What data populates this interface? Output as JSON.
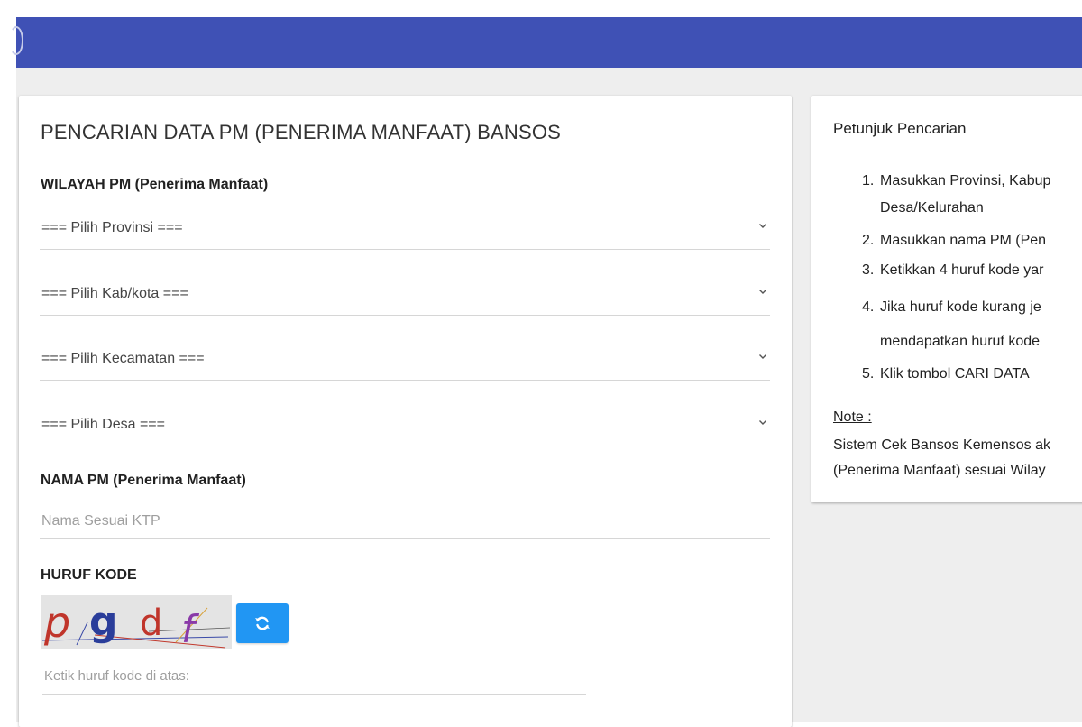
{
  "header": {
    "bar_color": "#3f51b5"
  },
  "search_form": {
    "title": "PENCARIAN DATA PM (PENERIMA MANFAAT) BANSOS",
    "wilayah_label": "WILAYAH PM (Penerima Manfaat)",
    "provinsi": {
      "selected": "=== Pilih Provinsi ==="
    },
    "kabkota": {
      "selected": "=== Pilih Kab/kota ==="
    },
    "kecamatan": {
      "selected": "=== Pilih Kecamatan ==="
    },
    "desa": {
      "selected": "=== Pilih Desa ==="
    },
    "nama_label": "NAMA PM (Penerima Manfaat)",
    "nama_input": {
      "placeholder": "Nama Sesuai KTP",
      "value": ""
    },
    "captcha_label": "HURUF KODE",
    "captcha_text": "pgdf",
    "captcha_input": {
      "placeholder": "Ketik huruf kode di atas:",
      "value": ""
    },
    "refresh_icon": "refresh-icon",
    "refresh_color": "#2196f3"
  },
  "instructions": {
    "title": "Petunjuk Pencarian",
    "steps": [
      {
        "num": "1.",
        "line1": "Masukkan Provinsi, Kabup",
        "line2": "Desa/Kelurahan"
      },
      {
        "num": "2.",
        "line1": "Masukkan nama PM (Pen"
      },
      {
        "num": "3.",
        "line1": "Ketikkan 4 huruf kode yar"
      },
      {
        "num": "4.",
        "line1": "Jika huruf kode kurang je",
        "line2": "mendapatkan huruf kode"
      },
      {
        "num": "5.",
        "line1": "Klik tombol CARI DATA"
      }
    ],
    "note_label": "Note :",
    "note_line1": "Sistem Cek Bansos Kemensos ak",
    "note_line2": "(Penerima Manfaat) sesuai Wilay"
  }
}
